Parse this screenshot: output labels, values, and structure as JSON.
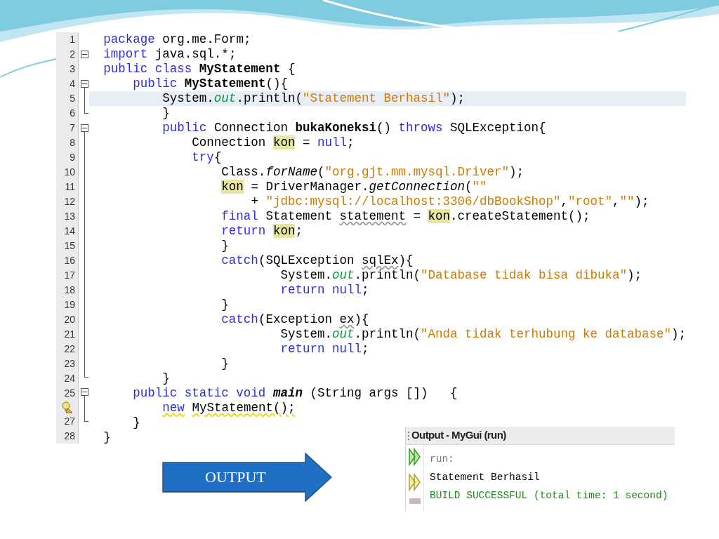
{
  "editor": {
    "lines": [
      {
        "number": "1",
        "kind": "plain",
        "tokens": [
          {
            "text": "package",
            "kind": "kw"
          },
          {
            "text": " org.me.Form;",
            "kind": "plain"
          }
        ]
      },
      {
        "number": "2",
        "kind": "fold-single",
        "tokens": [
          {
            "text": "import",
            "kind": "kw"
          },
          {
            "text": " java.sql.*;",
            "kind": "plain"
          }
        ]
      },
      {
        "number": "3",
        "kind": "plain",
        "tokens": [
          {
            "text": "public class ",
            "kind": "kw"
          },
          {
            "text": "MyStatement",
            "kind": "bold"
          },
          {
            "text": " {",
            "kind": "plain"
          }
        ]
      },
      {
        "number": "4",
        "kind": "fold-start",
        "tokens": [
          {
            "text": "    public ",
            "kind": "kw"
          },
          {
            "text": "MyStatement",
            "kind": "bold"
          },
          {
            "text": "(){",
            "kind": "plain"
          }
        ]
      },
      {
        "number": "5",
        "kind": "plain",
        "current": true,
        "tokens": [
          {
            "text": "        System.",
            "kind": "plain"
          },
          {
            "text": "out",
            "kind": "field"
          },
          {
            "text": ".println(",
            "kind": "plain"
          },
          {
            "text": "\"Statement Berhasil\"",
            "kind": "str"
          },
          {
            "text": ");",
            "kind": "plain"
          }
        ]
      },
      {
        "number": "6",
        "kind": "fold-end",
        "tokens": [
          {
            "text": "        }",
            "kind": "plain"
          }
        ]
      },
      {
        "number": "7",
        "kind": "fold-start",
        "tokens": [
          {
            "text": "        public",
            "kind": "kw"
          },
          {
            "text": " Connection ",
            "kind": "plain"
          },
          {
            "text": "bukaKoneksi",
            "kind": "bold"
          },
          {
            "text": "() ",
            "kind": "plain"
          },
          {
            "text": "throws",
            "kind": "kw"
          },
          {
            "text": " SQLException{",
            "kind": "plain"
          }
        ]
      },
      {
        "number": "8",
        "kind": "plain",
        "tokens": [
          {
            "text": "            Connection ",
            "kind": "plain"
          },
          {
            "text": "kon",
            "kind": "plain",
            "mark": true
          },
          {
            "text": " = ",
            "kind": "plain"
          },
          {
            "text": "null",
            "kind": "kw"
          },
          {
            "text": ";",
            "kind": "plain"
          }
        ]
      },
      {
        "number": "9",
        "kind": "plain",
        "tokens": [
          {
            "text": "            try",
            "kind": "kw"
          },
          {
            "text": "{",
            "kind": "plain"
          }
        ]
      },
      {
        "number": "10",
        "kind": "plain",
        "tokens": [
          {
            "text": "                Class.",
            "kind": "plain"
          },
          {
            "text": "forName",
            "kind": "italic"
          },
          {
            "text": "(",
            "kind": "plain"
          },
          {
            "text": "\"org.gjt.mm.mysql.Driver\"",
            "kind": "str"
          },
          {
            "text": ");",
            "kind": "plain"
          }
        ]
      },
      {
        "number": "11",
        "kind": "plain",
        "tokens": [
          {
            "text": "                kon",
            "kind": "plain",
            "mark": true
          },
          {
            "text": " = DriverManager.",
            "kind": "plain"
          },
          {
            "text": "getConnection",
            "kind": "italic"
          },
          {
            "text": "(",
            "kind": "plain"
          },
          {
            "text": "\"\"",
            "kind": "str"
          }
        ]
      },
      {
        "number": "12",
        "kind": "plain",
        "tokens": [
          {
            "text": "                    + ",
            "kind": "plain"
          },
          {
            "text": "\"jdbc:mysql://localhost:3306/dbBookShop\"",
            "kind": "str"
          },
          {
            "text": ",",
            "kind": "plain"
          },
          {
            "text": "\"root\"",
            "kind": "str"
          },
          {
            "text": ",",
            "kind": "plain"
          },
          {
            "text": "\"\"",
            "kind": "str"
          },
          {
            "text": ");",
            "kind": "plain"
          }
        ]
      },
      {
        "number": "13",
        "kind": "plain",
        "tokens": [
          {
            "text": "                final",
            "kind": "kw"
          },
          {
            "text": " Statement ",
            "kind": "plain"
          },
          {
            "text": "statement",
            "kind": "plain",
            "squiggle": true
          },
          {
            "text": " = ",
            "kind": "plain"
          },
          {
            "text": "kon",
            "kind": "plain",
            "mark": true
          },
          {
            "text": ".createStatement();",
            "kind": "plain"
          }
        ]
      },
      {
        "number": "14",
        "kind": "plain",
        "tokens": [
          {
            "text": "                return ",
            "kind": "kw"
          },
          {
            "text": "kon",
            "kind": "plain",
            "mark": true
          },
          {
            "text": ";",
            "kind": "plain"
          }
        ]
      },
      {
        "number": "15",
        "kind": "plain",
        "tokens": [
          {
            "text": "                }",
            "kind": "plain"
          }
        ]
      },
      {
        "number": "16",
        "kind": "plain",
        "tokens": [
          {
            "text": "                catch",
            "kind": "kw"
          },
          {
            "text": "(SQLException ",
            "kind": "plain"
          },
          {
            "text": "sqlEx",
            "kind": "plain",
            "squiggle": true
          },
          {
            "text": "){",
            "kind": "plain"
          }
        ]
      },
      {
        "number": "17",
        "kind": "plain",
        "tokens": [
          {
            "text": "                        System.",
            "kind": "plain"
          },
          {
            "text": "out",
            "kind": "field"
          },
          {
            "text": ".println(",
            "kind": "plain"
          },
          {
            "text": "\"Database tidak bisa dibuka\"",
            "kind": "str"
          },
          {
            "text": ");",
            "kind": "plain"
          }
        ]
      },
      {
        "number": "18",
        "kind": "plain",
        "tokens": [
          {
            "text": "                        return null",
            "kind": "kw"
          },
          {
            "text": ";",
            "kind": "plain"
          }
        ]
      },
      {
        "number": "19",
        "kind": "plain",
        "tokens": [
          {
            "text": "                }",
            "kind": "plain"
          }
        ]
      },
      {
        "number": "20",
        "kind": "plain",
        "tokens": [
          {
            "text": "                catch",
            "kind": "kw"
          },
          {
            "text": "(Exception ",
            "kind": "plain"
          },
          {
            "text": "ex",
            "kind": "plain",
            "squiggle": true
          },
          {
            "text": "){",
            "kind": "plain"
          }
        ]
      },
      {
        "number": "21",
        "kind": "plain",
        "tokens": [
          {
            "text": "                        System.",
            "kind": "plain"
          },
          {
            "text": "out",
            "kind": "field"
          },
          {
            "text": ".println(",
            "kind": "plain"
          },
          {
            "text": "\"Anda tidak terhubung ke database\"",
            "kind": "str"
          },
          {
            "text": ");",
            "kind": "plain"
          }
        ]
      },
      {
        "number": "22",
        "kind": "plain",
        "tokens": [
          {
            "text": "                        return null",
            "kind": "kw"
          },
          {
            "text": ";",
            "kind": "plain"
          }
        ]
      },
      {
        "number": "23",
        "kind": "plain",
        "tokens": [
          {
            "text": "                }",
            "kind": "plain"
          }
        ]
      },
      {
        "number": "24",
        "kind": "fold-end",
        "tokens": [
          {
            "text": "        }",
            "kind": "plain"
          }
        ]
      },
      {
        "number": "25",
        "kind": "fold-start",
        "tokens": [
          {
            "text": "    public static void ",
            "kind": "kw"
          },
          {
            "text": "main",
            "kind": "bolditalic"
          },
          {
            "text": " (String args [])   {",
            "kind": "plain"
          }
        ]
      },
      {
        "kind": "hint",
        "tokens": [
          {
            "text": "        new",
            "kind": "kw",
            "squiggle": true
          },
          {
            "text": " MyStatement();",
            "kind": "plain",
            "squiggle": true
          }
        ]
      },
      {
        "number": "27",
        "kind": "fold-end",
        "tokens": [
          {
            "text": "    }",
            "kind": "plain"
          }
        ]
      },
      {
        "number": "28",
        "kind": "plain",
        "tokens": [
          {
            "text": "}",
            "kind": "plain"
          }
        ]
      }
    ]
  },
  "arrow": {
    "label": "OUTPUT"
  },
  "output": {
    "title": "Output - MyGui (run)",
    "lines": [
      {
        "text": "run:",
        "kind": "info"
      },
      {
        "text": "Statement Berhasil",
        "kind": "normal"
      },
      {
        "text": "BUILD SUCCESSFUL (total time: 1 second)",
        "kind": "success"
      }
    ]
  }
}
